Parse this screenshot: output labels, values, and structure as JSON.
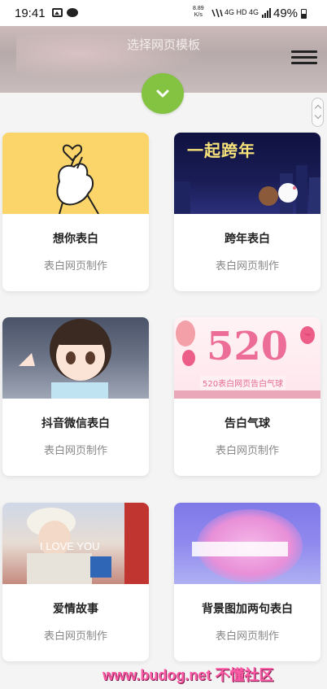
{
  "status_bar": {
    "time": "19:41",
    "net_speed_value": "8.89",
    "net_speed_unit": "K/s",
    "network_labels": "4G HD 4G",
    "battery": "49%"
  },
  "header": {
    "title": "选择网页模板",
    "menu_icon": "hamburger-menu-icon",
    "toggle_icon": "chevron-down-icon",
    "accent_color": "#84c341"
  },
  "cards": [
    {
      "title": "想你表白",
      "subtitle": "表白网页制作"
    },
    {
      "title": "跨年表白",
      "subtitle": "表白网页制作",
      "thumb_text": "一起跨年"
    },
    {
      "title": "抖音微信表白",
      "subtitle": "表白网页制作"
    },
    {
      "title": "告白气球",
      "subtitle": "表白网页制作",
      "thumb_text": "520",
      "thumb_caption": "520表白网页告白气球"
    },
    {
      "title": "爱情故事",
      "subtitle": "表白网页制作",
      "thumb_text": "I LOVE YOU"
    },
    {
      "title": "背景图加两句表白",
      "subtitle": "表白网页制作"
    }
  ],
  "watermark": "www.budog.net 不懂社区"
}
